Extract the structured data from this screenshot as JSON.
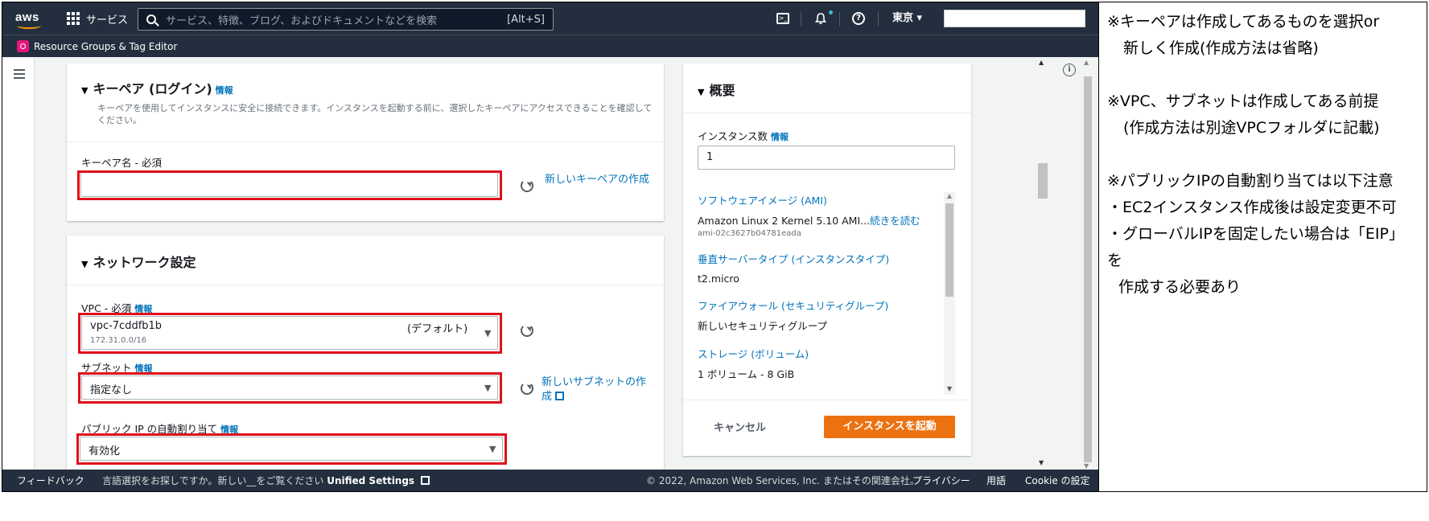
{
  "topnav": {
    "logo": "aws",
    "services_label": "サービス",
    "search_placeholder": "サービス、特徴、ブログ、およびドキュメントなどを検索",
    "search_shortcut": "[Alt+S]",
    "region": "東京 ▾"
  },
  "subbar": {
    "favorite": "Resource Groups & Tag Editor"
  },
  "keypair": {
    "title": "キーペア (ログイン)",
    "info": "情報",
    "description": "キーペアを使用してインスタンスに安全に接続できます。インスタンスを起動する前に、選択したキーペアにアクセスできることを確認してください。",
    "field_label": "キーペア名 - 必須",
    "field_value": "",
    "create_link": "新しいキーペアの作成"
  },
  "network": {
    "title": "ネットワーク設定",
    "vpc_label": "VPC - 必須",
    "vpc_info": "情報",
    "vpc_value": "vpc-7cddfb1b",
    "vpc_default": "(デフォルト)",
    "vpc_cidr": "172.31.0.0/16",
    "subnet_label": "サブネット",
    "subnet_info": "情報",
    "subnet_value": "指定なし",
    "subnet_create_link": "新しいサブネットの作成",
    "public_ip_label": "パブリック IP の自動割り当て",
    "public_ip_info": "情報",
    "public_ip_value": "有効化"
  },
  "summary": {
    "title": "概要",
    "instance_count_label": "インスタンス数",
    "instance_count_info": "情報",
    "instance_count_value": "1",
    "ami_label": "ソフトウェアイメージ (AMI)",
    "ami_value": "Amazon Linux 2 Kernel 5.10 AMI...",
    "ami_more": "続きを読む",
    "ami_id": "ami-02c3627b04781eada",
    "instance_type_label": "垂直サーバータイプ (インスタンスタイプ)",
    "instance_type_value": "t2.micro",
    "firewall_label": "ファイアウォール (セキュリティグループ)",
    "firewall_value": "新しいセキュリティグループ",
    "storage_label": "ストレージ (ボリューム)",
    "storage_value": "1 ボリューム - 8 GiB",
    "cancel": "キャンセル",
    "launch": "インスタンスを起動"
  },
  "footer": {
    "feedback": "フィードバック",
    "lang_prompt": "言語選択をお探しですか。新しい__をご覧ください",
    "unified_settings": "Unified Settings",
    "copyright": "© 2022, Amazon Web Services, Inc. またはその関連会社。",
    "privacy": "プライバシー",
    "terms": "用語",
    "cookie": "Cookie の設定"
  },
  "notes": {
    "line1": "※キーペアは作成してあるものを選択or",
    "line2": "新しく作成(作成方法は省略)",
    "line3": "※VPC、サブネットは作成してある前提",
    "line4": "(作成方法は別途VPCフォルダに記載)",
    "line5": "※パブリックIPの自動割り当ては以下注意",
    "line6": "・EC2インスタンス作成後は設定変更不可",
    "line7": "・グローバルIPを固定したい場合は「EIP」を",
    "line8": "作成する必要あり"
  },
  "colors": {
    "nav_bg": "#232f3e",
    "accent_orange": "#ec7211",
    "link_blue": "#0073bb",
    "highlight_red": "#e0101a"
  }
}
